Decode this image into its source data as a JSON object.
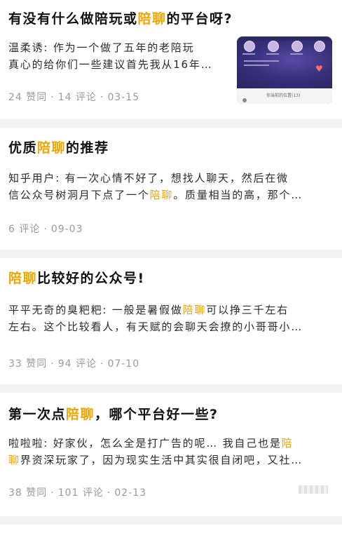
{
  "cards": [
    {
      "title_pre": "有没有什么做陪玩或",
      "title_hl": "陪聊",
      "title_post": "的平台呀?",
      "author": "温柔诱:",
      "line1": "作为一个做了五年的老陪玩",
      "line2": "真心的给你们一些建议首先我从16年…",
      "likes": "24 赞同",
      "comments": "14 评论",
      "date": "03-15",
      "thumb_caption": "你当前的位置(13)"
    },
    {
      "title_pre": "优质",
      "title_hl": "陪聊",
      "title_post": "的推荐",
      "author": "知乎用户:",
      "line1": "有一次心情不好了，想找人聊天，然后在微",
      "line2_pre": "信公众号树洞月下点了一个",
      "line2_hl": "陪聊",
      "line2_post": "。质量相当的高，那个…",
      "comments": "6 评论",
      "date": "09-03"
    },
    {
      "title_hl": "陪聊",
      "title_post": "比较好的公众号!",
      "author": "平平无奇的臭粑粑:",
      "line1_pre": "一般是暑假做",
      "line1_hl": "陪聊",
      "line1_post": "可以挣三千左右",
      "line2": "左右。这个比较看人，有天赋的会聊天会撩的小哥哥小…",
      "likes": "33 赞同",
      "comments": "94 评论",
      "date": "07-10"
    },
    {
      "title_pre": "第一次点",
      "title_hl": "陪聊",
      "title_post": "，哪个平台好一些?",
      "author": "啦啦啦:",
      "line1_pre": "好家伙，怎么全是打广告的呢… 我自己也是",
      "line1_hl": "陪",
      "line2_hl": "聊",
      "line2_post": "界资深玩家了，因为现实生活中其实很自闭吧，又社…",
      "likes": "38 赞同",
      "comments": "101 评论",
      "date": "02-13"
    }
  ]
}
